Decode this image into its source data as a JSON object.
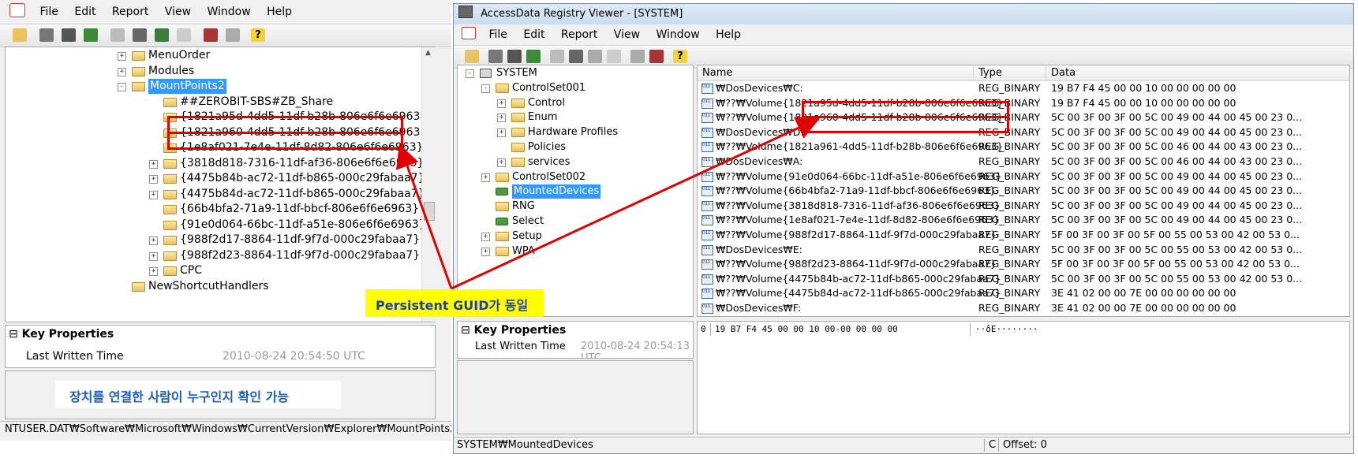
{
  "left_window": {
    "menu": [
      "File",
      "Edit",
      "Report",
      "View",
      "Window",
      "Help"
    ],
    "tree": [
      {
        "label": "MenuOrder",
        "expander": "+"
      },
      {
        "label": "Modules",
        "expander": "+"
      },
      {
        "label": "MountPoints2",
        "expander": "-",
        "selected": true
      },
      {
        "label": "##ZEROBIT-SBS#ZB_Share",
        "expander": ""
      },
      {
        "label": "{1821a95d-4dd5-11df-b28b-806e6f6e6963}",
        "expander": ""
      },
      {
        "label": "{1821a960-4dd5-11df-b28b-806e6f6e6963}",
        "expander": ""
      },
      {
        "label": "{1e8af021-7e4e-11df-8d82-806e6f6e6963}",
        "expander": ""
      },
      {
        "label": "{3818d818-7316-11df-af36-806e6f6e6963}",
        "expander": "+"
      },
      {
        "label": "{4475b84b-ac72-11df-b865-000c29fabaa7}",
        "expander": "+"
      },
      {
        "label": "{4475b84d-ac72-11df-b865-000c29fabaa7}",
        "expander": "+"
      },
      {
        "label": "{66b4bfa2-71a9-11df-bbcf-806e6f6e6963}",
        "expander": ""
      },
      {
        "label": "{91e0d064-66bc-11df-a51e-806e6f6e6963}",
        "expander": ""
      },
      {
        "label": "{988f2d17-8864-11df-9f7d-000c29fabaa7}",
        "expander": "+"
      },
      {
        "label": "{988f2d23-8864-11df-9f7d-000c29fabaa7}",
        "expander": "+"
      },
      {
        "label": "CPC",
        "expander": "+"
      },
      {
        "label": "NewShortcutHandlers",
        "expander": ""
      }
    ],
    "key_properties": {
      "title": "Key Properties",
      "field": "Last Written Time",
      "value": "2010-08-24 20:54:50 UTC",
      "collapse": "⊟"
    },
    "annotation": "장치를 연결한 사람이 누구인지 확인 가능",
    "status": "NTUSER.DAT₩Software₩Microsoft₩Windows₩CurrentVersion₩Explorer₩MountPoints2"
  },
  "right_window": {
    "title": "AccessData Registry Viewer - [SYSTEM]",
    "menu": [
      "File",
      "Edit",
      "Report",
      "View",
      "Window",
      "Help"
    ],
    "tree": [
      {
        "label": "SYSTEM",
        "expander": "-",
        "indent": 0,
        "icon": "computer"
      },
      {
        "label": "ControlSet001",
        "expander": "-",
        "indent": 1,
        "icon": "folder"
      },
      {
        "label": "Control",
        "expander": "+",
        "indent": 2,
        "icon": "folder"
      },
      {
        "label": "Enum",
        "expander": "+",
        "indent": 2,
        "icon": "folder"
      },
      {
        "label": "Hardware Profiles",
        "expander": "+",
        "indent": 2,
        "icon": "folder"
      },
      {
        "label": "Policies",
        "expander": "",
        "indent": 2,
        "icon": "folder"
      },
      {
        "label": "services",
        "expander": "+",
        "indent": 2,
        "icon": "folder"
      },
      {
        "label": "ControlSet002",
        "expander": "+",
        "indent": 1,
        "icon": "folder"
      },
      {
        "label": "MountedDevices",
        "expander": "",
        "indent": 1,
        "icon": "key",
        "selected": true
      },
      {
        "label": "RNG",
        "expander": "",
        "indent": 1,
        "icon": "folder"
      },
      {
        "label": "Select",
        "expander": "",
        "indent": 1,
        "icon": "key"
      },
      {
        "label": "Setup",
        "expander": "+",
        "indent": 1,
        "icon": "folder"
      },
      {
        "label": "WPA",
        "expander": "+",
        "indent": 1,
        "icon": "folder"
      }
    ],
    "columns": [
      "Name",
      "Type",
      "Data"
    ],
    "rows": [
      {
        "name": "₩DosDevices₩C:",
        "type": "REG_BINARY",
        "data": "19 B7 F4 45 00 00 10 00 00 00 00 00"
      },
      {
        "name": "₩??₩Volume{1821a95d-4dd5-11df-b28b-806e6f6e6963}",
        "type": "REG_BINARY",
        "data": "19 B7 F4 45 00 00 10 00 00 00 00 00"
      },
      {
        "name": "₩??₩Volume{1821a960-4dd5-11df-b28b-806e6f6e6963}",
        "type": "REG_BINARY",
        "data": "5C 00 3F 00 3F 00 5C 00 49 00 44 00 45 00 23 0..."
      },
      {
        "name": "₩DosDevices₩D:",
        "type": "REG_BINARY",
        "data": "5C 00 3F 00 3F 00 5C 00 49 00 44 00 45 00 23 0..."
      },
      {
        "name": "₩??₩Volume{1821a961-4dd5-11df-b28b-806e6f6e6963}",
        "type": "REG_BINARY",
        "data": "5C 00 3F 00 3F 00 5C 00 46 00 44 00 43 00 23 0..."
      },
      {
        "name": "₩DosDevices₩A:",
        "type": "REG_BINARY",
        "data": "5C 00 3F 00 3F 00 5C 00 46 00 44 00 43 00 23 0..."
      },
      {
        "name": "₩??₩Volume{91e0d064-66bc-11df-a51e-806e6f6e6963}",
        "type": "REG_BINARY",
        "data": "5C 00 3F 00 3F 00 5C 00 49 00 44 00 45 00 23 0..."
      },
      {
        "name": "₩??₩Volume{66b4bfa2-71a9-11df-bbcf-806e6f6e6963}",
        "type": "REG_BINARY",
        "data": "5C 00 3F 00 3F 00 5C 00 49 00 44 00 45 00 23 0..."
      },
      {
        "name": "₩??₩Volume{3818d818-7316-11df-af36-806e6f6e6963}",
        "type": "REG_BINARY",
        "data": "5C 00 3F 00 3F 00 5C 00 49 00 44 00 45 00 23 0..."
      },
      {
        "name": "₩??₩Volume{1e8af021-7e4e-11df-8d82-806e6f6e6963}",
        "type": "REG_BINARY",
        "data": "5C 00 3F 00 3F 00 5C 00 49 00 44 00 45 00 23 0..."
      },
      {
        "name": "₩??₩Volume{988f2d17-8864-11df-9f7d-000c29fabaa7}",
        "type": "REG_BINARY",
        "data": "5F 00 3F 00 3F 00 5F 00 55 00 53 00 42 00 53 0..."
      },
      {
        "name": "₩DosDevices₩E:",
        "type": "REG_BINARY",
        "data": "5C 00 3F 00 3F 00 5C 00 55 00 53 00 42 00 53 0..."
      },
      {
        "name": "₩??₩Volume{988f2d23-8864-11df-9f7d-000c29fabaa7}",
        "type": "REG_BINARY",
        "data": "5F 00 3F 00 3F 00 5F 00 55 00 53 00 42 00 53 0..."
      },
      {
        "name": "₩??₩Volume{4475b84b-ac72-11df-b865-000c29fabaa7}",
        "type": "REG_BINARY",
        "data": "5C 00 3F 00 3F 00 5C 00 55 00 53 00 42 00 53 0..."
      },
      {
        "name": "₩??₩Volume{4475b84d-ac72-11df-b865-000c29fabaa7}",
        "type": "REG_BINARY",
        "data": "3E 41 02 00 00 7E 00 00 00 00 00 00"
      },
      {
        "name": "₩DosDevices₩F:",
        "type": "REG_BINARY",
        "data": "3E 41 02 00 00 7E 00 00 00 00 00 00"
      }
    ],
    "key_properties": {
      "title": "Key Properties",
      "field": "Last Written Time",
      "value": "2010-08-24 20:54:13 UTC",
      "collapse": "⊟"
    },
    "hex": {
      "offset": "0",
      "bytes": "19 B7 F4 45 00 00 10 00-00 00 00 00",
      "ascii": "··ôE········"
    },
    "status": {
      "path": "SYSTEM₩MountedDevices",
      "mode": "C",
      "offset": "Offset: 0"
    }
  },
  "callout": {
    "text": "Persistent GUID가 동일",
    "bg": "#ffff00",
    "text_color": "#1f3fae",
    "arrow_color": "#e00000"
  },
  "colors": {
    "highlight": "#3399ff",
    "annotation_text": "#1a5fb4",
    "red": "#e00000"
  }
}
